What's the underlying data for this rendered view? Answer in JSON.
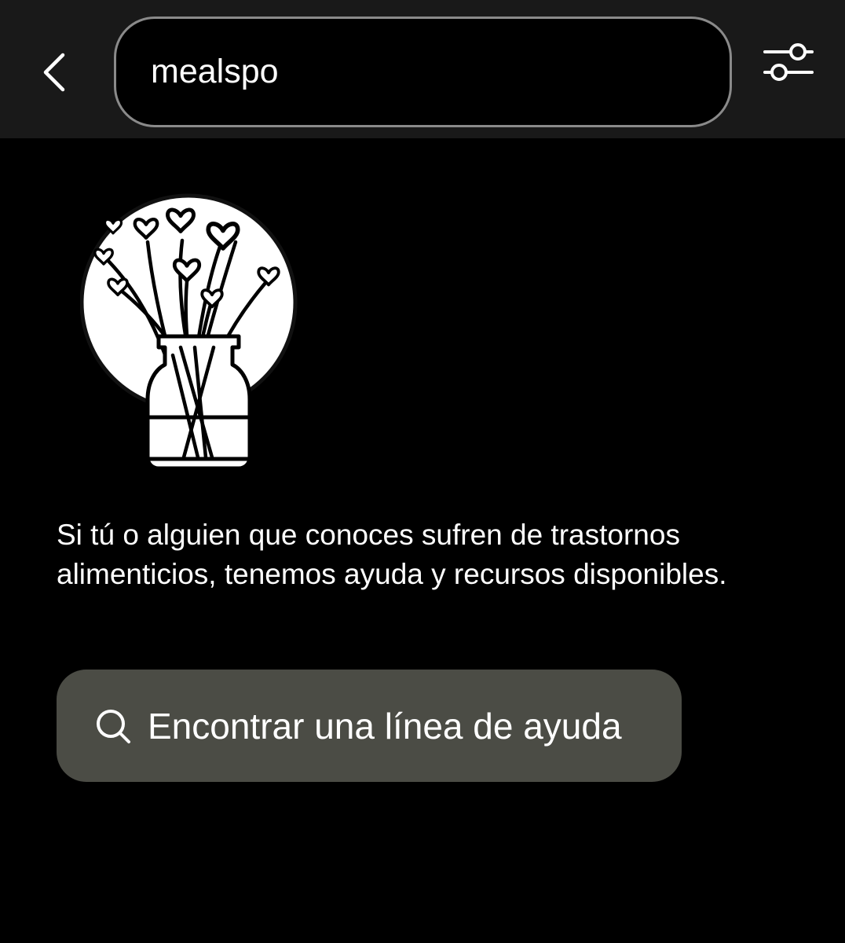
{
  "header": {
    "back_icon": "chevron-left-icon",
    "search": {
      "value": "mealspo",
      "placeholder": ""
    },
    "filter_icon": "sliders-icon"
  },
  "illustration": {
    "icon": "vase-with-heart-flowers-icon"
  },
  "support": {
    "message": "Si tú o alguien que conoces sufren de trastornos alimenticios, tenemos ayuda y recursos disponibles.",
    "button_label": "Encontrar una línea de ayuda",
    "button_icon": "search-icon"
  },
  "colors": {
    "background": "#000000",
    "header_background": "#191919",
    "search_border": "#8a8a8a",
    "button_background": "#4b4c45",
    "text": "#ffffff"
  }
}
